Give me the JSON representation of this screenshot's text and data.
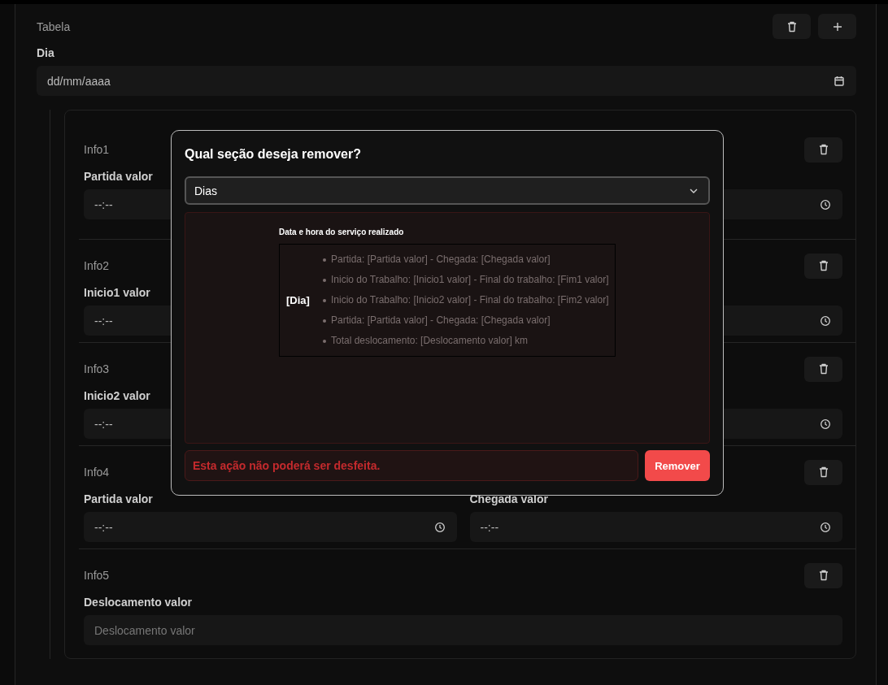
{
  "header": {
    "title": "Tabela"
  },
  "day": {
    "label": "Dia",
    "placeholder": "dd/mm/aaaa"
  },
  "sections": [
    {
      "title": "Info1",
      "fields": [
        {
          "kind": "time",
          "label": "Partida valor",
          "placeholder": "--:--"
        },
        {
          "kind": "time"
        }
      ]
    },
    {
      "title": "Info2",
      "fields": [
        {
          "kind": "time",
          "label": "Inicio1 valor",
          "placeholder": "--:--"
        },
        {
          "kind": "time"
        }
      ]
    },
    {
      "title": "Info3",
      "fields": [
        {
          "kind": "time",
          "label": "Inicio2 valor",
          "placeholder": "--:--"
        },
        {
          "kind": "time"
        }
      ]
    },
    {
      "title": "Info4",
      "fields": [
        {
          "kind": "time",
          "label": "Partida valor",
          "placeholder": "--:--"
        },
        {
          "kind": "time",
          "label": "Chegada valor",
          "placeholder": "--:--"
        }
      ]
    },
    {
      "title": "Info5",
      "fields": [
        {
          "kind": "text",
          "label": "Deslocamento valor",
          "placeholder": "Deslocamento valor"
        }
      ]
    }
  ],
  "dialog": {
    "title": "Qual seção deseja remover?",
    "select": {
      "value": "Dias"
    },
    "preview": {
      "heading": "Data e hora do serviço realizado",
      "day": "[Dia]",
      "items": [
        "Partida: [Partida valor] - Chegada: [Chegada valor]",
        "Inicio do Trabalho: [Inicio1 valor] - Final do trabalho: [Fim1 valor]",
        "Inicio do Trabalho: [Inicio2 valor] - Final do trabalho: [Fim2 valor]",
        "Partida: [Partida valor] - Chegada: [Chegada valor]",
        "Total deslocamento: [Deslocamento valor] km"
      ]
    },
    "warning": "Esta ação não poderá ser desfeita.",
    "button": "Remover"
  }
}
